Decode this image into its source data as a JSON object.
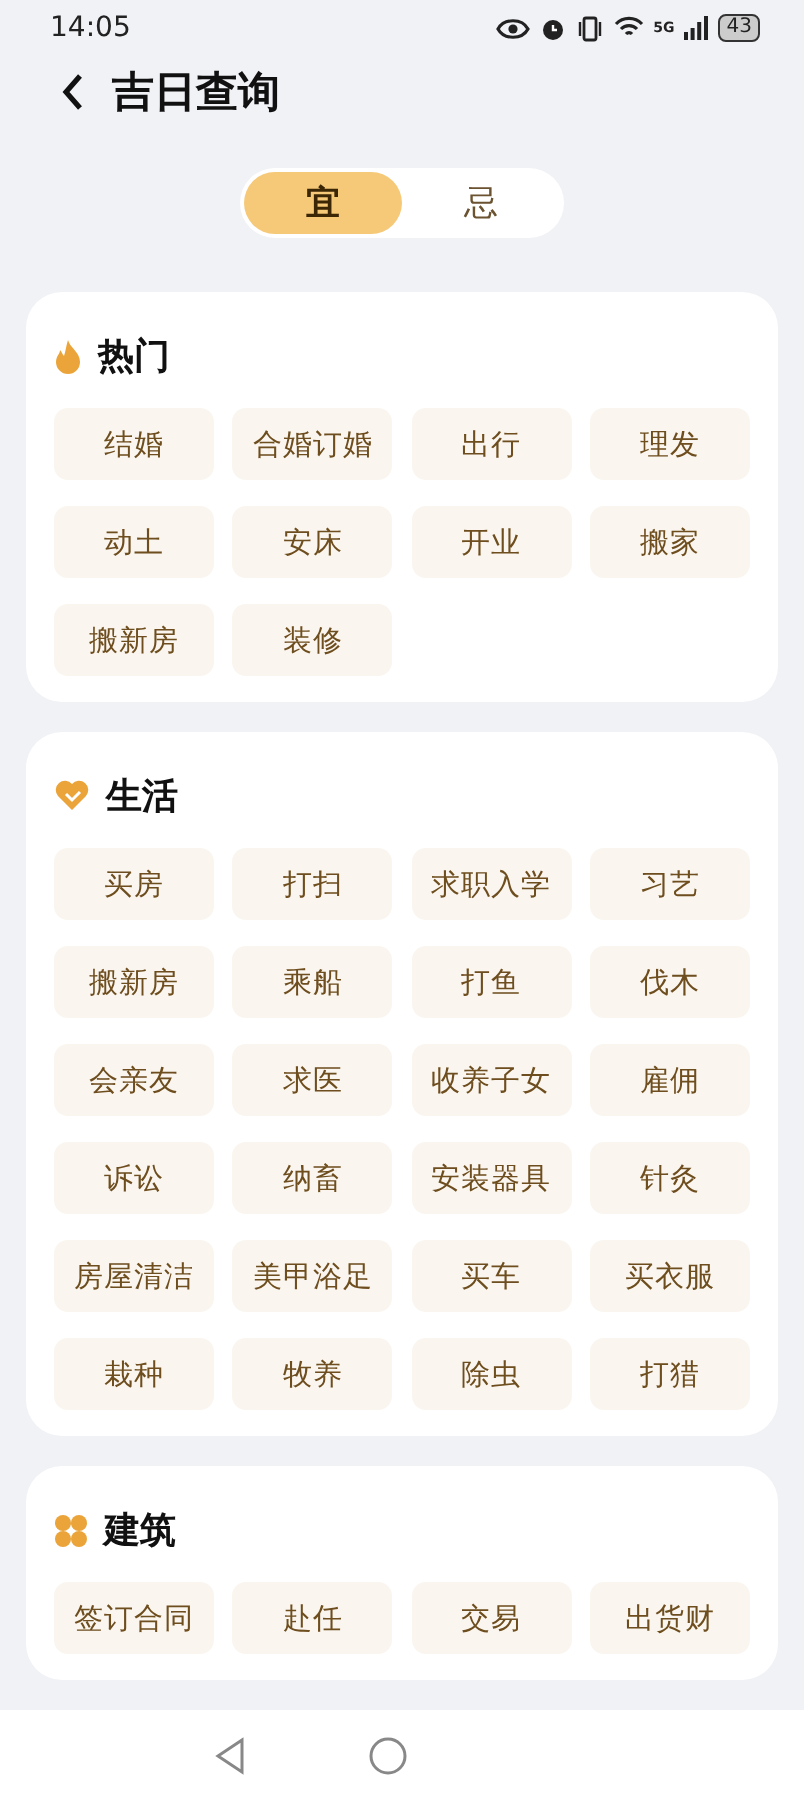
{
  "status_bar": {
    "time": "14:05",
    "network": "5G",
    "battery": "43"
  },
  "header": {
    "title": "吉日查询"
  },
  "tabs": [
    {
      "label": "宜",
      "selected": true
    },
    {
      "label": "忌",
      "selected": false
    }
  ],
  "sections": [
    {
      "title": "热门",
      "kind": "fire",
      "items": [
        "结婚",
        "合婚订婚",
        "出行",
        "理发",
        "动土",
        "安床",
        "开业",
        "搬家",
        "搬新房",
        "装修"
      ]
    },
    {
      "title": "生活",
      "kind": "heart",
      "items": [
        "买房",
        "打扫",
        "求职入学",
        "习艺",
        "搬新房",
        "乘船",
        "打鱼",
        "伐木",
        "会亲友",
        "求医",
        "收养子女",
        "雇佣",
        "诉讼",
        "纳畜",
        "安装器具",
        "针灸",
        "房屋清洁",
        "美甲浴足",
        "买车",
        "买衣服",
        "栽种",
        "牧养",
        "除虫",
        "打猎"
      ]
    },
    {
      "title": "建筑",
      "kind": "clover",
      "items": [
        "签订合同",
        "赴任",
        "交易",
        "出货财"
      ]
    }
  ]
}
